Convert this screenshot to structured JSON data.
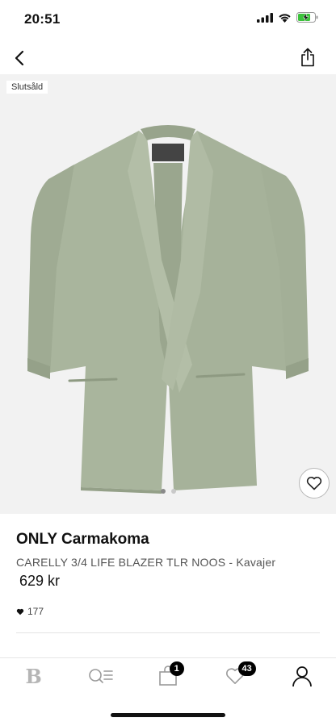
{
  "status_bar": {
    "time": "20:51"
  },
  "product": {
    "badge": "Slutsåld",
    "brand": "ONLY Carmakoma",
    "name": "CARELLY 3/4 LIFE BLAZER TLR NOOS - Kavajer",
    "price": "629 kr",
    "likes": "177",
    "image": {
      "label_brand": "ONLY",
      "label_sub": "CARMAKOMA",
      "color": "#a8b49c"
    },
    "carousel": {
      "count": 2,
      "active": 1
    }
  },
  "tab_bar": {
    "home_logo": "B",
    "cart_badge": "1",
    "favorites_badge": "43"
  },
  "colors": {
    "accent": "#111111",
    "badge_bg": "#000000",
    "image_bg": "#f2f2f2"
  }
}
